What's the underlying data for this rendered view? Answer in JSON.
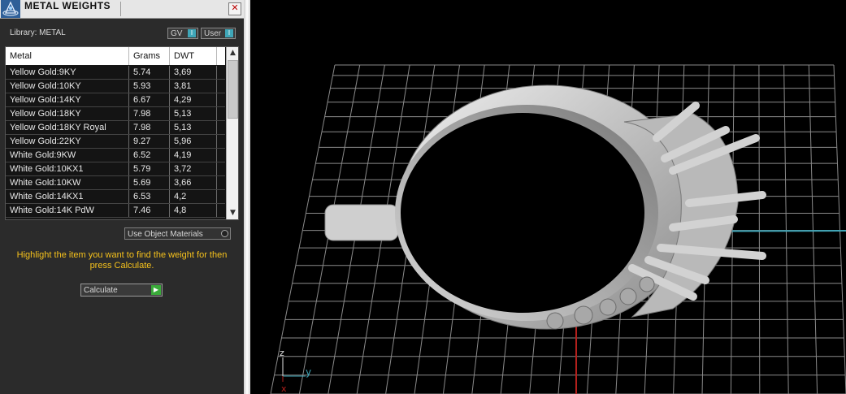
{
  "title": "METAL WEIGHTS",
  "library_label": "Library: METAL",
  "toggles": {
    "gv": "GV",
    "user": "User",
    "knob_glyph": "I"
  },
  "close_glyph": "✕",
  "table": {
    "headers": [
      "Metal",
      "Grams",
      "DWT"
    ],
    "rows": [
      [
        "Yellow Gold:9KY",
        "5.74",
        "3,69"
      ],
      [
        "Yellow Gold:10KY",
        "5.93",
        "3,81"
      ],
      [
        "Yellow Gold:14KY",
        "6.67",
        "4,29"
      ],
      [
        "Yellow Gold:18KY",
        "7.98",
        "5,13"
      ],
      [
        "Yellow Gold:18KY Royal",
        "7.98",
        "5,13"
      ],
      [
        "Yellow Gold:22KY",
        "9.27",
        "5,96"
      ],
      [
        "White Gold:9KW",
        "6.52",
        "4,19"
      ],
      [
        "White Gold:10KX1",
        "5.79",
        "3,72"
      ],
      [
        "White Gold:10KW",
        "5.69",
        "3,66"
      ],
      [
        "White Gold:14KX1",
        "6.53",
        "4,2"
      ],
      [
        "White Gold:14K PdW",
        "7.46",
        "4,8"
      ]
    ]
  },
  "use_object_materials": "Use Object Materials",
  "instruction": "Highlight the item you want to find the weight for then press Calculate.",
  "calculate_label": "Calculate",
  "axes": {
    "z": "z",
    "y": "y",
    "x": "x"
  },
  "colors": {
    "panel_bg": "#2b2b2b",
    "accent_yellow": "#f6c21c",
    "grid": "#8a8a8a",
    "axis_x": "#b3201c",
    "axis_y": "#3fa6b8",
    "ring": "#c9c9c9"
  }
}
